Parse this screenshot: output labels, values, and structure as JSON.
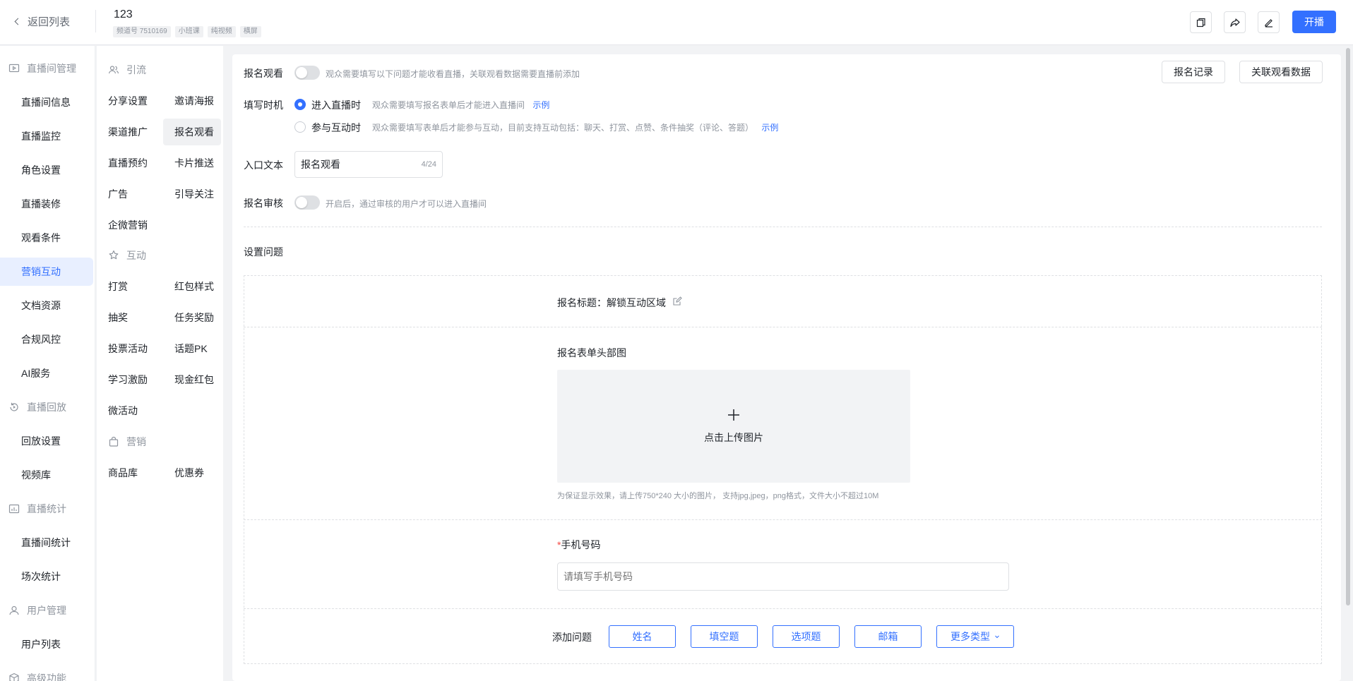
{
  "header": {
    "back_label": "返回列表",
    "title": "123",
    "tags": [
      "频道号 7510169",
      "小班课",
      "纯视频",
      "横屏"
    ],
    "start_label": "开播"
  },
  "sidebar": {
    "groups": {
      "live_manage": "直播间管理",
      "playback": "直播回放",
      "stats": "直播统计",
      "users": "用户管理",
      "advanced": "高级功能"
    },
    "items": {
      "info": "直播间信息",
      "monitor": "直播监控",
      "roles": "角色设置",
      "decor": "直播装修",
      "conditions": "观看条件",
      "marketing": "营销互动",
      "docs": "文档资源",
      "compliance": "合规风控",
      "ai": "AI服务",
      "playback_settings": "回放设置",
      "video_lib": "视频库",
      "room_stats": "直播间统计",
      "session_stats": "场次统计",
      "user_list": "用户列表"
    }
  },
  "submenu": {
    "groups": {
      "traffic": "引流",
      "interact": "互动",
      "marketing": "营销"
    },
    "items": {
      "share": "分享设置",
      "poster": "邀请海报",
      "channel": "渠道推广",
      "signup": "报名观看",
      "reserve": "直播预约",
      "card": "卡片推送",
      "ads": "广告",
      "follow": "引导关注",
      "wecom": "企微营销",
      "tip": "打赏",
      "redpack_style": "红包样式",
      "lottery": "抽奖",
      "task": "任务奖励",
      "vote": "投票活动",
      "pk": "话题PK",
      "learn": "学习激励",
      "cash": "现金红包",
      "micro": "微活动",
      "goods": "商品库",
      "coupon": "优惠券"
    }
  },
  "form": {
    "signup_label": "报名观看",
    "signup_hint": "观众需要填写以下问题才能收看直播，关联观看数据需要直播前添加",
    "records_btn": "报名记录",
    "link_data_btn": "关联观看数据",
    "timing_label": "填写时机",
    "opt1_label": "进入直播时",
    "opt1_hint": "观众需要填写报名表单后才能进入直播间",
    "opt2_label": "参与互动时",
    "opt2_hint": "观众需要填写表单后才能参与互动，目前支持互动包括：聊天、打赏、点赞、条件抽奖（评论、答题）",
    "example": "示例",
    "entry_label": "入口文本",
    "entry_value": "报名观看",
    "entry_count": "4/24",
    "review_label": "报名审核",
    "review_hint": "开启后，通过审核的用户才可以进入直播间",
    "questions_title": "设置问题",
    "form_title_label": "报名标题：",
    "form_title_value": "解锁互动区域",
    "header_img_label": "报名表单头部图",
    "upload_label": "点击上传图片",
    "upload_hint": "为保证显示效果，请上传750*240 大小的图片， 支持jpg,jpeg，png格式，文件大小不超过10M",
    "phone_required": "*",
    "phone_label": "手机号码",
    "phone_placeholder": "请填写手机号码",
    "add_q_label": "添加问题",
    "q_buttons": [
      "姓名",
      "填空题",
      "选项题",
      "邮箱"
    ],
    "more_types": "更多类型"
  },
  "colors": {
    "accent": "#3370ff",
    "active_bg": "#e8efff"
  }
}
